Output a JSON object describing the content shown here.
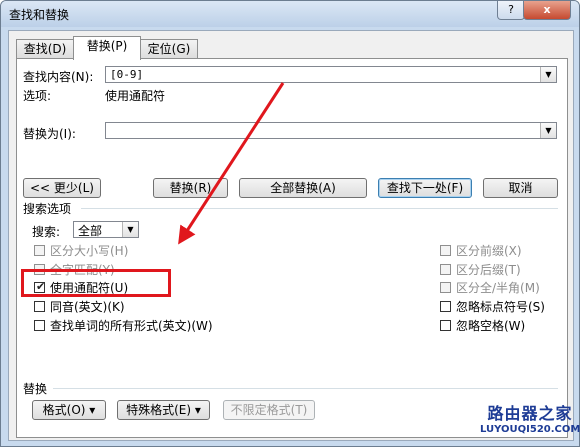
{
  "window": {
    "title": "查找和替换",
    "help_label": "?",
    "close_label": "x"
  },
  "tabs": [
    {
      "label": "查找(D)"
    },
    {
      "label": "替换(P)"
    },
    {
      "label": "定位(G)"
    }
  ],
  "find": {
    "label": "查找内容(N):",
    "value": "[0-9]",
    "options_label": "选项:",
    "options_value": "使用通配符"
  },
  "replace": {
    "label": "替换为(I):",
    "value": ""
  },
  "buttons": {
    "less": "<< 更少(L)",
    "replace": "替换(R)",
    "replace_all": "全部替换(A)",
    "find_next": "查找下一处(F)",
    "cancel": "取消"
  },
  "search_options": {
    "header": "搜索选项",
    "search_label": "搜索:",
    "search_value": "全部",
    "left": [
      {
        "label": "区分大小写(H)",
        "checked": false,
        "enabled": false
      },
      {
        "label": "全字匹配(Y)",
        "checked": false,
        "enabled": false
      },
      {
        "label": "使用通配符(U)",
        "checked": true,
        "enabled": true
      },
      {
        "label": "同音(英文)(K)",
        "checked": false,
        "enabled": true
      },
      {
        "label": "查找单词的所有形式(英文)(W)",
        "checked": false,
        "enabled": true
      }
    ],
    "right": [
      {
        "label": "区分前缀(X)",
        "checked": false,
        "enabled": false
      },
      {
        "label": "区分后缀(T)",
        "checked": false,
        "enabled": false
      },
      {
        "label": "区分全/半角(M)",
        "checked": false,
        "enabled": false
      },
      {
        "label": "忽略标点符号(S)",
        "checked": false,
        "enabled": true
      },
      {
        "label": "忽略空格(W)",
        "checked": false,
        "enabled": true
      }
    ]
  },
  "replace_section": {
    "header": "替换",
    "format": "格式(O)",
    "special": "特殊格式(E)",
    "no_format": "不限定格式(T)"
  },
  "watermark": {
    "line1": "路由器之家",
    "line2": "LUYOUQI520.COM"
  }
}
